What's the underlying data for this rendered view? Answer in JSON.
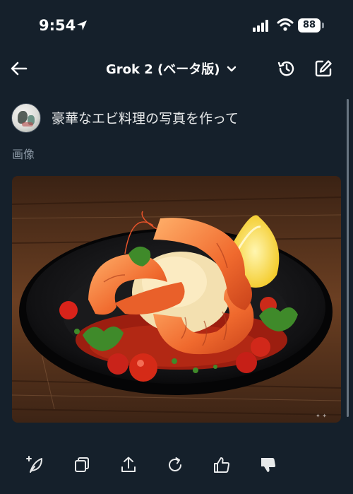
{
  "status_bar": {
    "time": "9:54",
    "battery": "88",
    "icons": [
      "location-arrow-icon",
      "cellular-signal-icon",
      "wifi-icon",
      "battery-icon"
    ]
  },
  "header": {
    "model_name": "Grok 2 (ベータ版)",
    "icons": [
      "back-arrow-icon",
      "chevron-down-icon",
      "history-icon",
      "new-chat-icon"
    ]
  },
  "message": {
    "prompt": "豪華なエビ料理の写真を作って",
    "response_label": "画像"
  },
  "actions": {
    "icons": [
      "regenerate-sparkle-icon",
      "copy-icon",
      "share-icon",
      "refresh-icon",
      "thumbs-up-icon",
      "thumbs-down-icon"
    ]
  },
  "colors": {
    "background": "#15202b",
    "text_primary": "#e7e9ea",
    "text_secondary": "#8b98a5"
  }
}
